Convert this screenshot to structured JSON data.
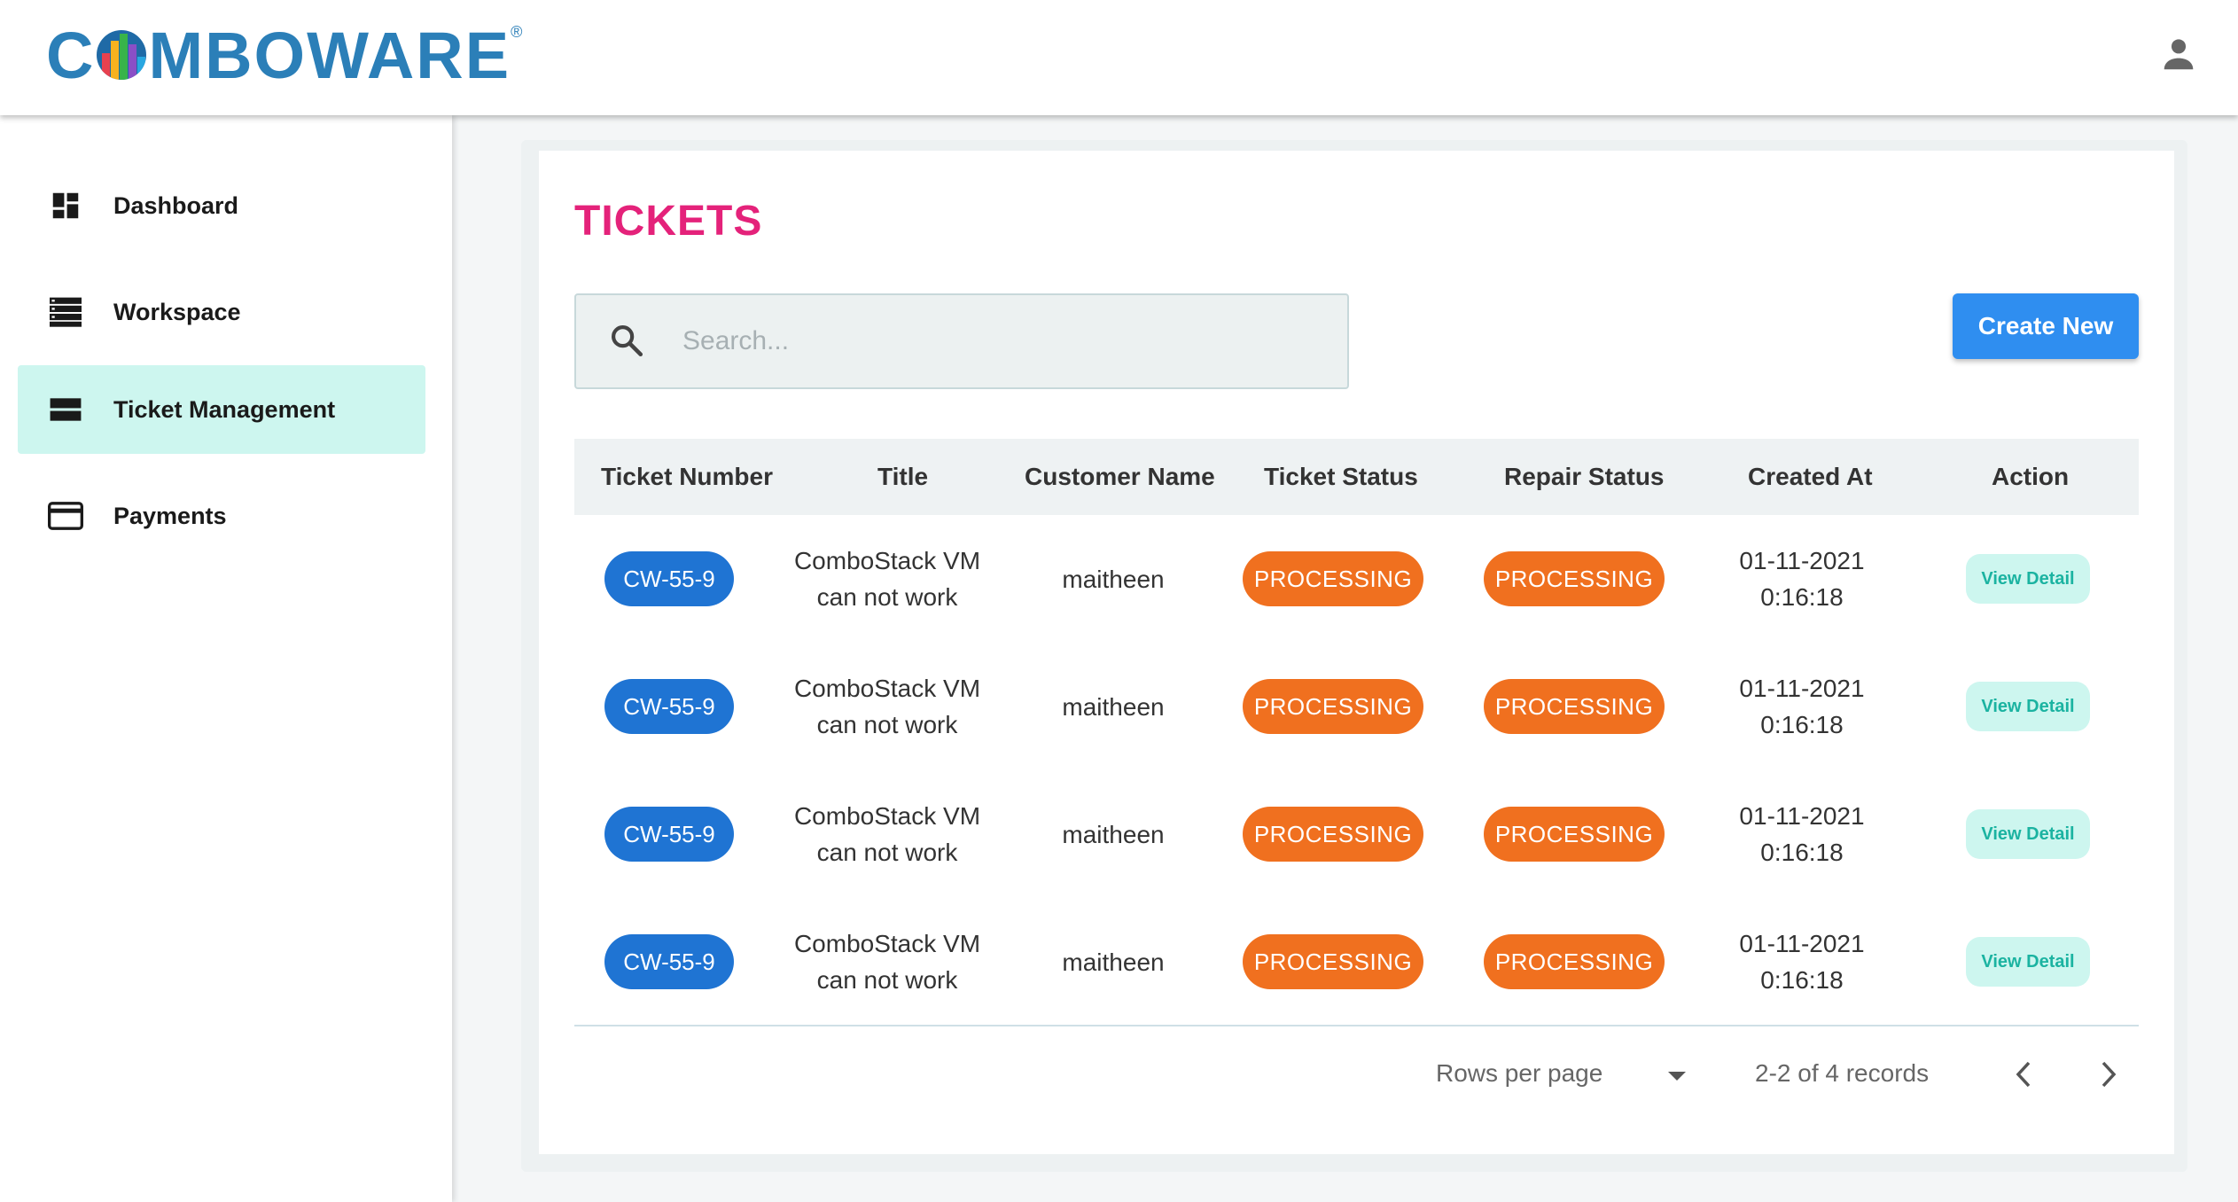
{
  "header": {
    "logo_text_left": "C",
    "logo_text_right": "MBOWARE",
    "logo_registered": "®",
    "brand_color": "#2b7fb8",
    "user_icon": "user-icon"
  },
  "sidebar": {
    "items": [
      {
        "label": "Dashboard",
        "icon": "dashboard-icon",
        "active": false
      },
      {
        "label": "Workspace",
        "icon": "workspace-icon",
        "active": false
      },
      {
        "label": "Ticket Management",
        "icon": "ticket-icon",
        "active": true
      },
      {
        "label": "Payments",
        "icon": "payments-icon",
        "active": false
      }
    ],
    "active_color": "#cdf6ef"
  },
  "main": {
    "title": "TICKETS",
    "title_color": "#e4227a",
    "search": {
      "placeholder": "Search...",
      "value": ""
    },
    "create_label": "Create New",
    "table": {
      "columns": [
        "Ticket Number",
        "Title",
        "Customer Name",
        "Ticket Status",
        "Repair Status",
        "Created At",
        "Action"
      ],
      "rows": [
        {
          "ticket": "CW-55-9",
          "title_line1": "ComboStack VM",
          "title_line2": "can not work",
          "customer": "maitheen",
          "ticket_status": "PROCESSING",
          "repair_status": "PROCESSING",
          "created_date": "01-11-2021",
          "created_time": "0:16:18",
          "action": "View Detail"
        },
        {
          "ticket": "CW-55-9",
          "title_line1": "ComboStack VM",
          "title_line2": "can not work",
          "customer": "maitheen",
          "ticket_status": "PROCESSING",
          "repair_status": "PROCESSING",
          "created_date": "01-11-2021",
          "created_time": "0:16:18",
          "action": "View Detail"
        },
        {
          "ticket": "CW-55-9",
          "title_line1": "ComboStack VM",
          "title_line2": "can not work",
          "customer": "maitheen",
          "ticket_status": "PROCESSING",
          "repair_status": "PROCESSING",
          "created_date": "01-11-2021",
          "created_time": "0:16:18",
          "action": "View Detail"
        },
        {
          "ticket": "CW-55-9",
          "title_line1": "ComboStack VM",
          "title_line2": "can not work",
          "customer": "maitheen",
          "ticket_status": "PROCESSING",
          "repair_status": "PROCESSING",
          "created_date": "01-11-2021",
          "created_time": "0:16:18",
          "action": "View Detail"
        }
      ],
      "status_color": "#f0701f",
      "ticket_color": "#1f74d3"
    },
    "pagination": {
      "rows_per_page_label": "Rows per page",
      "rows_per_page_value": "",
      "range_text": "2-2 of 4 records",
      "prev_icon": "chevron-left-icon",
      "next_icon": "chevron-right-icon"
    }
  }
}
